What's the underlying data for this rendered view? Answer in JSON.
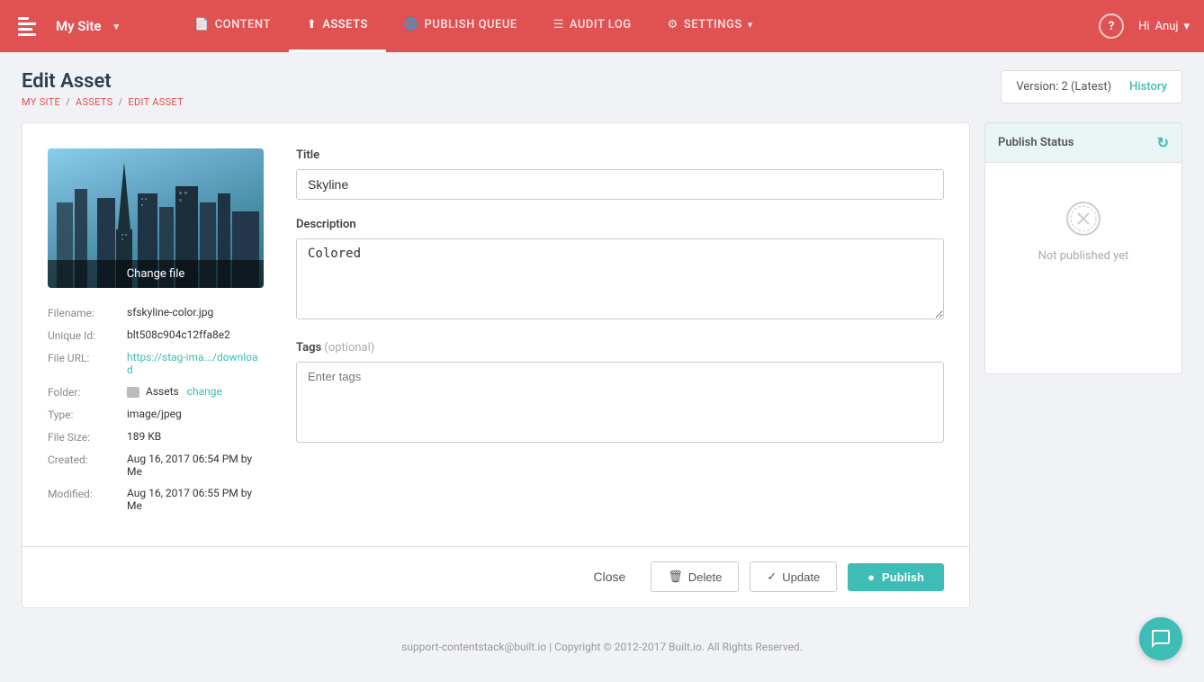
{
  "topnav": {
    "logo_text": "My Site",
    "logo_dropdown": "▾",
    "links": [
      {
        "id": "content",
        "label": "CONTENT",
        "icon": "📄",
        "active": false
      },
      {
        "id": "assets",
        "label": "ASSETS",
        "icon": "⬆",
        "active": true
      },
      {
        "id": "publish-queue",
        "label": "PUBLISH QUEUE",
        "icon": "🌐",
        "active": false
      },
      {
        "id": "audit-log",
        "label": "AUDIT LOG",
        "icon": "☰",
        "active": false
      },
      {
        "id": "settings",
        "label": "SETTINGS",
        "icon": "⚙",
        "active": false
      }
    ],
    "help_label": "?",
    "user_greeting": "Hi",
    "user_name": "Anuj",
    "user_dropdown": "▾"
  },
  "breadcrumb": {
    "parts": [
      "MY SITE",
      "ASSETS",
      "EDIT ASSET"
    ],
    "separators": [
      "/",
      "/"
    ]
  },
  "page": {
    "title": "Edit Asset",
    "version_label": "Version: 2 (Latest)",
    "history_label": "History"
  },
  "asset": {
    "filename": "sfskyline-color.jpg",
    "unique_id": "blt508c904c12ffa8e2",
    "file_url": "https://stag-ima.../download",
    "folder": "Assets",
    "type": "image/jpeg",
    "file_size": "189 KB",
    "created": "Aug 16, 2017 06:54 PM by",
    "created_by": "Me",
    "modified": "Aug 16, 2017 06:55 PM by",
    "modified_by": "Me",
    "change_file_label": "Change file",
    "change_folder_label": "change"
  },
  "form": {
    "title_label": "Title",
    "title_value": "Skyline",
    "description_label": "Description",
    "description_value": "Colored",
    "tags_label": "Tags",
    "tags_optional": "(optional)",
    "tags_placeholder": "Enter tags"
  },
  "publish_status": {
    "header": "Publish Status",
    "status_text": "Not published yet"
  },
  "footer": {
    "close_label": "Close",
    "delete_label": "Delete",
    "update_label": "Update",
    "publish_label": "Publish",
    "copyright": "support-contentstack@built.io | Copyright © 2012-2017 Built.io. All Rights Reserved."
  }
}
